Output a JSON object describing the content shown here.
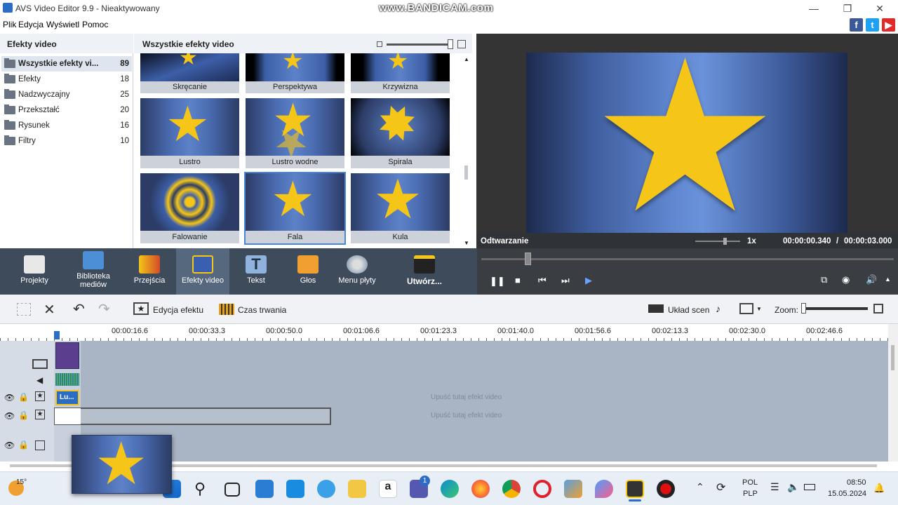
{
  "window": {
    "title": "AVS Video Editor 9.9 - Nieaktywowany",
    "watermark": "www.BANDICAM.com"
  },
  "menu": [
    "Plik",
    "Edycja",
    "Wyświetl",
    "Pomoc"
  ],
  "left_panel": {
    "header": "Efekty video",
    "items": [
      {
        "label": "Wszystkie efekty vi...",
        "count": "89",
        "selected": true
      },
      {
        "label": "Efekty",
        "count": "18"
      },
      {
        "label": "Nadzwyczajny",
        "count": "25"
      },
      {
        "label": "Przekształć",
        "count": "20"
      },
      {
        "label": "Rysunek",
        "count": "16"
      },
      {
        "label": "Filtry",
        "count": "10"
      }
    ]
  },
  "grid": {
    "header": "Wszystkie efekty video",
    "effects": [
      "Skręcanie",
      "Perspektywa",
      "Krzywizna",
      "Lustro",
      "Lustro wodne",
      "Spirala",
      "Falowanie",
      "Fala",
      "Kula"
    ],
    "selected": "Fala"
  },
  "preview": {
    "status": "Odtwarzanie",
    "speed": "1x",
    "current": "00:00:00.340",
    "separator": "/",
    "total": "00:00:03.000"
  },
  "toolbar": [
    "Projekty",
    "Biblioteka mediów",
    "Przejścia",
    "Efekty video",
    "Tekst",
    "Głos",
    "Menu płyty",
    "Utwórz..."
  ],
  "timeline_tools": {
    "edit_effect": "Edycja efektu",
    "duration": "Czas trwania",
    "scene_layout": "Układ scen",
    "zoom": "Zoom:"
  },
  "ruler": [
    "00:00:16.6",
    "00:00:33.3",
    "00:00:50.0",
    "00:01:06.6",
    "00:01:23.3",
    "00:01:40.0",
    "00:01:56.6",
    "00:02:13.3",
    "00:02:30.0",
    "00:02:46.6"
  ],
  "tracks": {
    "drop_hint_1": "Upuść tutaj efekt video",
    "drop_hint_2": "Upuść tutaj efekt video",
    "clip_label": "Lu..."
  },
  "taskbar": {
    "weather": "15°",
    "lang1": "POL",
    "lang2": "PLP",
    "time": "08:50",
    "date": "15.05.2024",
    "badge": "1"
  },
  "colors": {
    "accent_blue": "#2b6cc4",
    "toolbar_bg": "#3e4b5b",
    "star": "#f5c518"
  }
}
